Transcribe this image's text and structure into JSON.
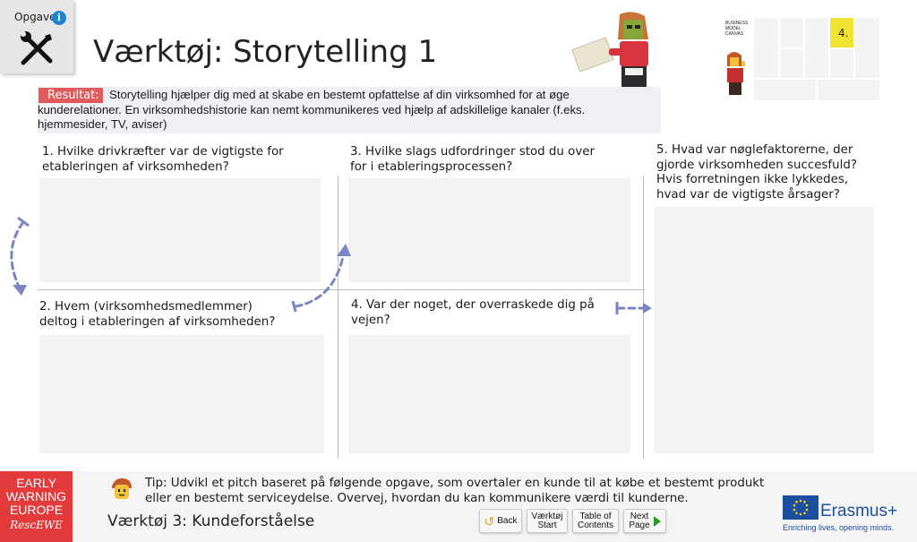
{
  "task": {
    "label": "Opgave:",
    "info_icon": "info-icon",
    "tool_icon": "tools-icon"
  },
  "title": "Værktøj: Storytelling 1",
  "canvas_thumb": {
    "label_lines": [
      "BUSINESS",
      "MODEL",
      "CANVAS"
    ],
    "highlight_number": "4.",
    "highlight_color": "#f0e433"
  },
  "result": {
    "tag": "Resultat:",
    "text_line1": "Storytelling hjælper dig med at skabe en bestemt opfattelse af din virksomhed for at øge",
    "text_line2": "kunderelationer. En virksomhedshistorie kan nemt kommunikeres ved hjælp af adskillelige kanaler (f.eks.",
    "text_line3": "hjemmesider, TV, aviser)"
  },
  "questions": {
    "q1": {
      "line1": "1. Hvilke drivkræfter var de vigtigste for",
      "line2": "etableringen af virksomheden?"
    },
    "q2": {
      "line1": "2. Hvem (virksomhedsmedlemmer)",
      "line2": "deltog i etableringen af virksomheden?"
    },
    "q3": {
      "line1": "3. Hvilke slags udfordringer stod du over",
      "line2": "for i etableringsprocessen?"
    },
    "q4": {
      "line1": "4. Var der noget, der overraskede dig på",
      "line2": "vejen?"
    },
    "q5": {
      "line1": "5. Hvad var nøglefaktorerne, der",
      "line2": "gjorde virksomheden succesfuld?",
      "line3": "Hvis forretningen ikke lykkedes,",
      "line4": "hvad var de vigtigste årsager?"
    }
  },
  "logo": {
    "line1": "EARLY",
    "line2": "WARNING",
    "line3": "EUROPE",
    "line4": "RescEWE"
  },
  "tip": {
    "line1": "Tip: Udvikl et pitch baseret på følgende opgave, som overtaler en kunde til at købe et bestemt produkt",
    "line2": "eller en bestemt serviceydelse. Overvej, hvordan du kan kommunikere værdi til kunderne."
  },
  "footer_section": "Værktøj 3: Kundeforståelse",
  "nav": {
    "back": "Back",
    "start_line1": "Værktøj",
    "start_line2": "Start",
    "toc_line1": "Table of",
    "toc_line2": "Contents",
    "next_line1": "Next",
    "next_line2": "Page"
  },
  "erasmus": {
    "name": "Erasmus+",
    "tagline": "Enriching lives, opening minds."
  },
  "colors": {
    "accent_red": "#e33b3b",
    "arrow_blue": "#7a86c2",
    "info_blue": "#1c84d4",
    "erasmus_blue": "#1d4fa0"
  }
}
